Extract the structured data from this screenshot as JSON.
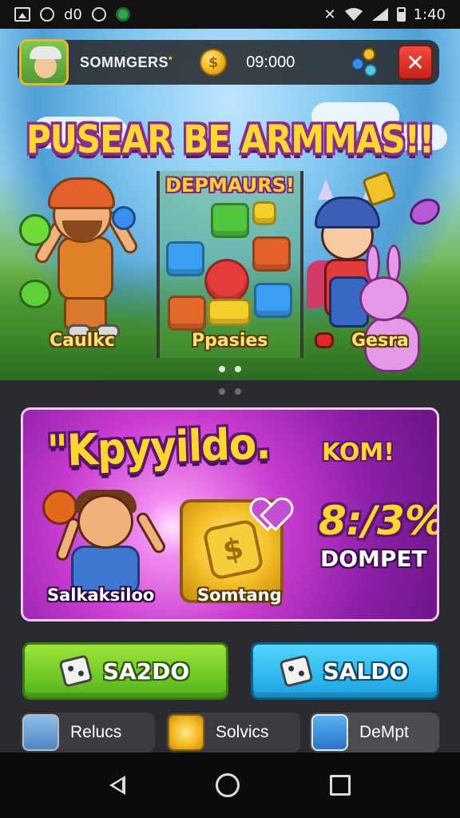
{
  "status_bar": {
    "left_text": "d0",
    "time": "1:40",
    "icons": [
      "image-icon",
      "alarm-icon",
      "clock-icon",
      "app-notification-icon",
      "mute-icon",
      "wifi-icon",
      "signal-icon",
      "battery-icon"
    ]
  },
  "hud": {
    "player_name": "SOMMGERS",
    "name_star": "*",
    "coin_symbol": "$",
    "coins": "09:000",
    "close_symbol": "✕"
  },
  "hero": {
    "title": "PUSEAR BE ARMMAS!!",
    "middle_title": "DEPMAURS!",
    "labels": [
      "Caulkc",
      "Ppasies",
      "Gesra"
    ],
    "carousel_pages": 2,
    "carousel_active": 1
  },
  "promo": {
    "title": "\"Kpyyildo.",
    "subtitle": "KOM!",
    "big_value": "8:/3%",
    "dompet": "DOMPET",
    "treasure_symbol": "$",
    "label_left": "Salkaksiloo",
    "label_center": "Somtang"
  },
  "buttons": {
    "green_label": "SA2DO",
    "blue_label": "SALDO"
  },
  "tabs": [
    {
      "label": "Relucs",
      "icon": "character-icon"
    },
    {
      "label": "Solvics",
      "icon": "coin-icon"
    },
    {
      "label": "DeMpt",
      "icon": "wallet-icon"
    }
  ],
  "colors": {
    "title_yellow": "#ffd92e",
    "title_outline": "#8a2d8e",
    "promo_purple": "#c93cd0",
    "button_green": "#52b41a",
    "button_blue": "#1aa2e0",
    "close_red": "#e0362a"
  }
}
